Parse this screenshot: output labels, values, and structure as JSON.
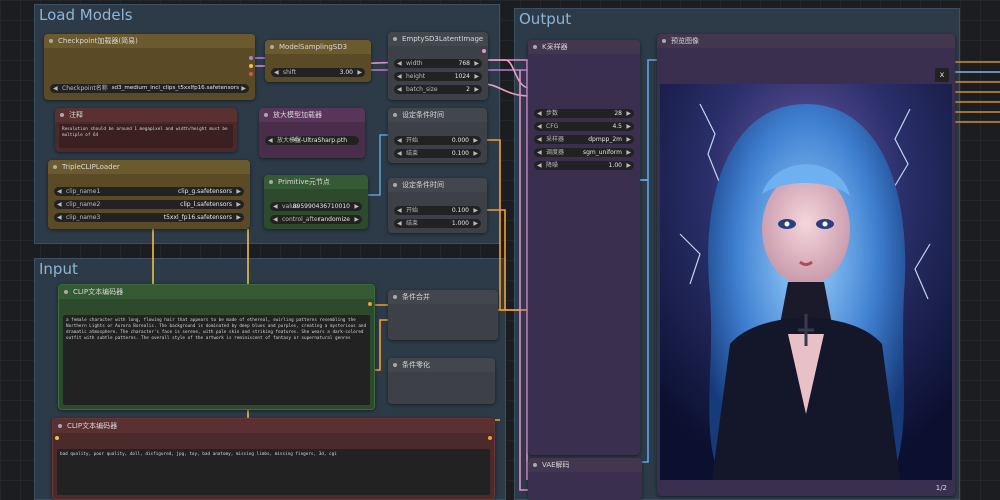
{
  "groups": {
    "load_models": "Load Models",
    "input": "Input",
    "output": "Output"
  },
  "nodes": {
    "checkpoint": {
      "title": "Checkpoint加载器(简易)",
      "ckpt_label": "Checkpoint名称",
      "ckpt_value": "sd3_medium_incl_clips_t5xxlfp16.safetensors"
    },
    "model_sampling": {
      "title": "ModelSamplingSD3",
      "shift_label": "shift",
      "shift_value": "3.00"
    },
    "empty_latent": {
      "title": "EmptySD3LatentImage",
      "width_label": "width",
      "width_value": "768",
      "height_label": "height",
      "height_value": "1024",
      "batch_label": "batch_size",
      "batch_value": "2"
    },
    "note": {
      "title": "注释",
      "text": "Resolution should be around 1 megapixel and width/height must be multiple of 64"
    },
    "upscale_loader": {
      "title": "放大模型加载器",
      "model_label": "放大模型",
      "model_value": "4x-UltraSharp.pth"
    },
    "cond_a": {
      "title": "设定条件时间",
      "start_label": "开始",
      "start_value": "0.000",
      "end_label": "结束",
      "end_value": "0.100"
    },
    "triple_clip": {
      "title": "TripleCLIPLoader",
      "clip1_label": "clip_name1",
      "clip1_value": "clip_g.safetensors",
      "clip2_label": "clip_name2",
      "clip2_value": "clip_l.safetensors",
      "clip3_label": "clip_name3",
      "clip3_value": "t5xxl_fp16.safetensors"
    },
    "primitive": {
      "title": "Primitive元节点",
      "value_label": "value",
      "value_value": "895990436710010",
      "control_label": "control_after",
      "control_value": "randomize"
    },
    "cond_b": {
      "title": "设定条件时间",
      "start_label": "开始",
      "start_value": "0.100",
      "end_label": "结束",
      "end_value": "1.000"
    },
    "clip_pos": {
      "title": "CLIP文本编码器",
      "text": "a female character with long, flowing hair that appears to be made of ethereal, swirling patterns resembling the Northern Lights or Aurora Borealis. The background is dominated by deep blues and purples, creating a mysterious and dramatic atmosphere. The character's face is serene, with pale skin and striking features. She wears a dark-colored outfit with subtle patterns. The overall style of the artwork is reminiscent of fantasy or supernatural genres"
    },
    "clip_neg": {
      "title": "CLIP文本编码器",
      "text": "bad quality, poor quality, doll, disfigured, jpg, toy, bad anatomy, missing limbs, missing fingers, 3d, cgi"
    },
    "cond_combine": {
      "title": "条件合并"
    },
    "cond_zero": {
      "title": "条件零化"
    },
    "ksampler": {
      "title": "K采样器",
      "steps_label": "步数",
      "steps_value": "28",
      "cfg_label": "CFG",
      "cfg_value": "4.5",
      "sampler_label": "采样器",
      "sampler_value": "dpmpp_2m",
      "scheduler_label": "调度器",
      "scheduler_value": "sgm_uniform",
      "denoise_label": "降噪",
      "denoise_value": "1.00"
    },
    "vae_decode": {
      "title": "VAE解码"
    },
    "preview": {
      "title": "预览图像",
      "close_label": "x",
      "counter": "1/2"
    }
  },
  "colors": {
    "group_bg": "#2c3b47",
    "yellow_node": "#5a4a26",
    "red_node": "#4a2a2a",
    "green_node": "#2d4a2d",
    "purple_node": "#4a2d4a",
    "canvas": "#1b1d20"
  }
}
